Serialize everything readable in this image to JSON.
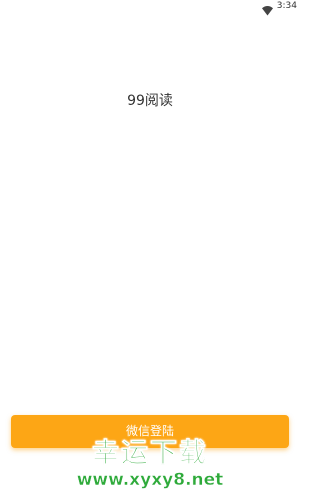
{
  "status_bar": {
    "time": "3:34",
    "wifi_icon": "wifi-icon"
  },
  "app": {
    "title": "99阅读"
  },
  "login": {
    "button_label": "微信登陆",
    "button_color": "#fda615"
  },
  "watermark": {
    "text": "幸运下载",
    "url": "www.xyxy8.net",
    "color": "#2eaa3a"
  }
}
